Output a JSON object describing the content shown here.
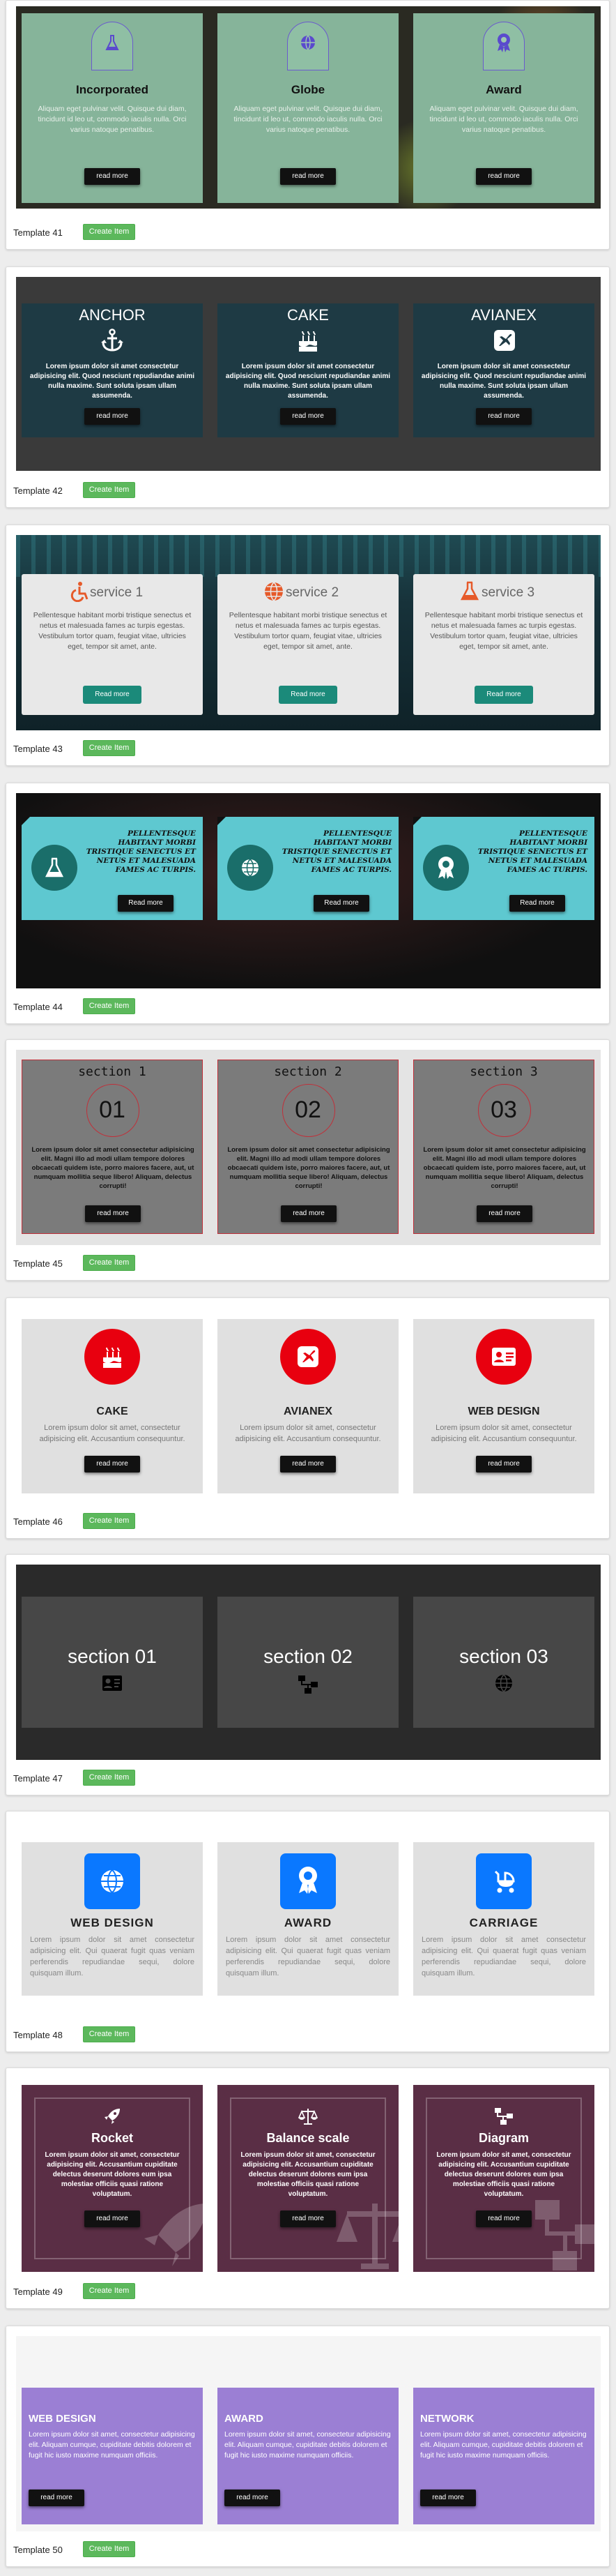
{
  "create_label": "Create Item",
  "templates": [
    {
      "name": "Template 41",
      "cards": [
        {
          "title": "Incorporated",
          "icon": "flask-icon",
          "text": "Aliquam eget pulvinar velit. Quisque dui diam, tincidunt id leo ut, commodo iaculis nulla. Orci varius natoque penatibus.",
          "button": "read more"
        },
        {
          "title": "Globe",
          "icon": "globe-icon",
          "text": "Aliquam eget pulvinar velit. Quisque dui diam, tincidunt id leo ut, commodo iaculis nulla. Orci varius natoque penatibus.",
          "button": "read more"
        },
        {
          "title": "Award",
          "icon": "award-icon",
          "text": "Aliquam eget pulvinar velit. Quisque dui diam, tincidunt id leo ut, commodo iaculis nulla. Orci varius natoque penatibus.",
          "button": "read more"
        }
      ]
    },
    {
      "name": "Template 42",
      "cards": [
        {
          "title": "ANCHOR",
          "icon": "anchor-icon",
          "text": "Lorem ipsum dolor sit amet consectetur adipisicing elit. Quod nesciunt repudiandae animi nulla maxime. Sunt soluta ipsam ullam assumenda.",
          "button": "read more"
        },
        {
          "title": "CAKE",
          "icon": "cake-icon",
          "text": "Lorem ipsum dolor sit amet consectetur adipisicing elit. Quod nesciunt repudiandae animi nulla maxime. Sunt soluta ipsam ullam assumenda.",
          "button": "read more"
        },
        {
          "title": "AVIANEX",
          "icon": "avianex-icon",
          "text": "Lorem ipsum dolor sit amet consectetur adipisicing elit. Quod nesciunt repudiandae animi nulla maxime. Sunt soluta ipsam ullam assumenda.",
          "button": "read more"
        }
      ]
    },
    {
      "name": "Template 43",
      "cards": [
        {
          "title": "service 1",
          "icon": "wheelchair-icon",
          "text": "Pellentesque habitant morbi tristique senectus et netus et malesuada fames ac turpis egestas. Vestibulum tortor quam, feugiat vitae, ultricies eget, tempor sit amet, ante.",
          "button": "Read more"
        },
        {
          "title": "service 2",
          "icon": "globe-icon",
          "text": "Pellentesque habitant morbi tristique senectus et netus et malesuada fames ac turpis egestas. Vestibulum tortor quam, feugiat vitae, ultricies eget, tempor sit amet, ante.",
          "button": "Read more"
        },
        {
          "title": "service 3",
          "icon": "flask-icon",
          "text": "Pellentesque habitant morbi tristique senectus et netus et malesuada fames ac turpis egestas. Vestibulum tortor quam, feugiat vitae, ultricies eget, tempor sit amet, ante.",
          "button": "Read more"
        }
      ]
    },
    {
      "name": "Template 44",
      "cards": [
        {
          "icon": "flask-icon",
          "text": "PELLENTESQUE HABITANT MORBI TRISTIQUE SENECTUS ET NETUS ET MALESUADA FAMES AC TURPIS.",
          "button": "Read more"
        },
        {
          "icon": "globe-icon",
          "text": "PELLENTESQUE HABITANT MORBI TRISTIQUE SENECTUS ET NETUS ET MALESUADA FAMES AC TURPIS.",
          "button": "Read more"
        },
        {
          "icon": "award-icon",
          "text": "PELLENTESQUE HABITANT MORBI TRISTIQUE SENECTUS ET NETUS ET MALESUADA FAMES AC TURPIS.",
          "button": "Read more"
        }
      ]
    },
    {
      "name": "Template 45",
      "cards": [
        {
          "title": "section 1",
          "number": "01",
          "text": "Lorem ipsum dolor sit amet consectetur adipisicing elit. Magni illo ad modi ullam tempore dolores obcaecati quidem iste, porro maiores facere, aut, ut numquam mollitia seque libero! Aliquam, delectus corrupti!",
          "button": "read more"
        },
        {
          "title": "section 2",
          "number": "02",
          "text": "Lorem ipsum dolor sit amet consectetur adipisicing elit. Magni illo ad modi ullam tempore dolores obcaecati quidem iste, porro maiores facere, aut, ut numquam mollitia seque libero! Aliquam, delectus corrupti!",
          "button": "read more"
        },
        {
          "title": "section 3",
          "number": "03",
          "text": "Lorem ipsum dolor sit amet consectetur adipisicing elit. Magni illo ad modi ullam tempore dolores obcaecati quidem iste, porro maiores facere, aut, ut numquam mollitia seque libero! Aliquam, delectus corrupti!",
          "button": "read more"
        }
      ]
    },
    {
      "name": "Template 46",
      "cards": [
        {
          "title": "CAKE",
          "icon": "cake-icon",
          "text": "Lorem ipsum dolor sit amet, consectetur adipisicing elit. Accusantium consequuntur.",
          "button": "read more"
        },
        {
          "title": "AVIANEX",
          "icon": "avianex-icon",
          "text": "Lorem ipsum dolor sit amet, consectetur adipisicing elit. Accusantium consequuntur.",
          "button": "read more"
        },
        {
          "title": "WEB DESIGN",
          "icon": "id-card-icon",
          "text": "Lorem ipsum dolor sit amet, consectetur adipisicing elit. Accusantium consequuntur.",
          "button": "read more"
        }
      ]
    },
    {
      "name": "Template 47",
      "cards": [
        {
          "title": "section 01",
          "icon": "id-card-icon"
        },
        {
          "title": "section 02",
          "icon": "sitemap-icon"
        },
        {
          "title": "section 03",
          "icon": "globe-icon"
        }
      ]
    },
    {
      "name": "Template 48",
      "cards": [
        {
          "title": "WEB DESIGN",
          "icon": "globe-icon",
          "text": "Lorem ipsum dolor sit amet consectetur adipisicing elit. Qui quaerat fugit quas veniam perferendis repudiandae sequi, dolore quisquam illum."
        },
        {
          "title": "AWARD",
          "icon": "award-icon",
          "text": "Lorem ipsum dolor sit amet consectetur adipisicing elit. Qui quaerat fugit quas veniam perferendis repudiandae sequi, dolore quisquam illum."
        },
        {
          "title": "CARRIAGE",
          "icon": "carriage-icon",
          "text": "Lorem ipsum dolor sit amet consectetur adipisicing elit. Qui quaerat fugit quas veniam perferendis repudiandae sequi, dolore quisquam illum."
        }
      ]
    },
    {
      "name": "Template 49",
      "cards": [
        {
          "title": "Rocket",
          "icon": "rocket-icon",
          "text": "Lorem ipsum dolor sit amet, consectetur adipisicing elit. Accusantium cupiditate delectus deserunt dolores eum ipsa molestiae officiis quasi ratione voluptatum.",
          "button": "read more"
        },
        {
          "title": "Balance scale",
          "icon": "balance-scale-icon",
          "text": "Lorem ipsum dolor sit amet, consectetur adipisicing elit. Accusantium cupiditate delectus deserunt dolores eum ipsa molestiae officiis quasi ratione voluptatum.",
          "button": "read more"
        },
        {
          "title": "Diagram",
          "icon": "sitemap-icon",
          "text": "Lorem ipsum dolor sit amet, consectetur adipisicing elit. Accusantium cupiditate delectus deserunt dolores eum ipsa molestiae officiis quasi ratione voluptatum.",
          "button": "read more"
        }
      ]
    },
    {
      "name": "Template 50",
      "cards": [
        {
          "title": "WEB DESIGN",
          "text": "Lorem ipsum dolor sit amet, consectetur adipisicing elit. Aliquam cumque, cupiditate debitis dolorem et fugit hic iusto maxime numquam officiis.",
          "button": "read more"
        },
        {
          "title": "AWARD",
          "text": "Lorem ipsum dolor sit amet, consectetur adipisicing elit. Aliquam cumque, cupiditate debitis dolorem et fugit hic iusto maxime numquam officiis.",
          "button": "read more"
        },
        {
          "title": "NETWORK",
          "text": "Lorem ipsum dolor sit amet, consectetur adipisicing elit. Aliquam cumque, cupiditate debitis dolorem et fugit hic iusto maxime numquam officiis.",
          "button": "read more"
        }
      ]
    }
  ]
}
